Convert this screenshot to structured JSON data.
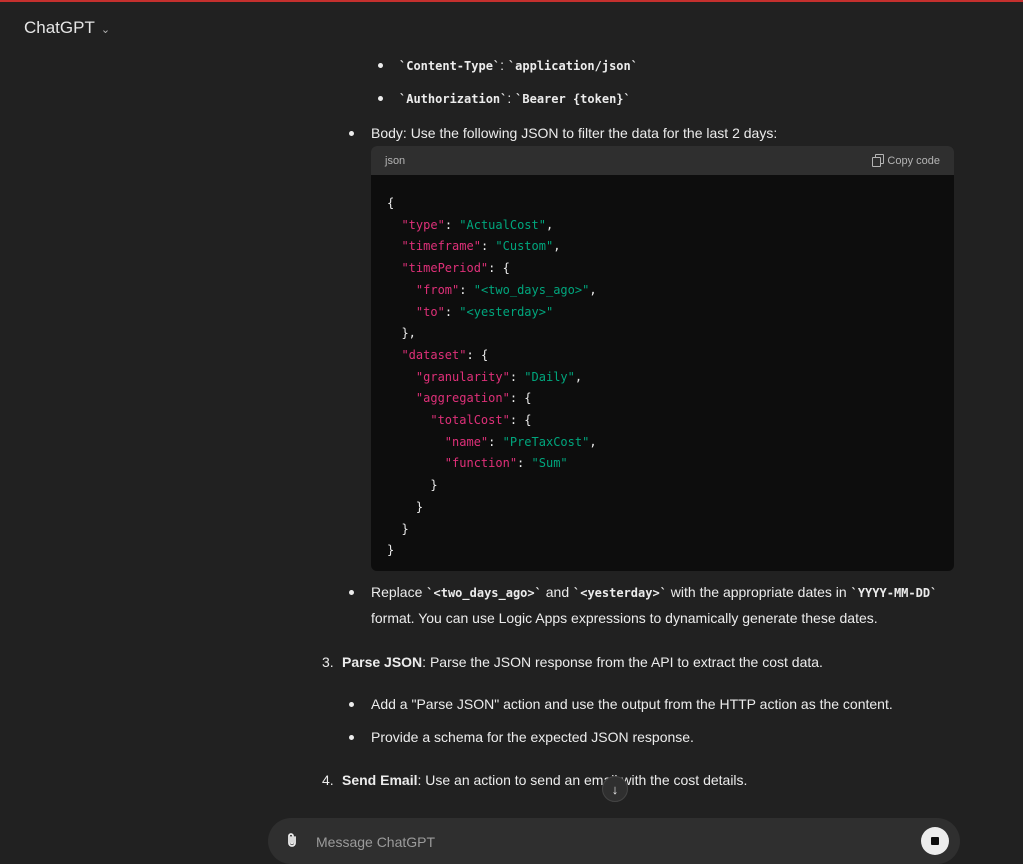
{
  "app": {
    "title": "ChatGPT",
    "chevron": "⌄"
  },
  "headers": {
    "content_type_key": "`Content-Type`",
    "content_type_sep": ": ",
    "content_type_val": "`application/json`",
    "auth_key": "`Authorization`",
    "auth_sep": ": ",
    "auth_val": "`Bearer {token}`"
  },
  "body_line": "Body: Use the following JSON to filter the data for the last 2 days:",
  "code": {
    "language": "json",
    "copy_label": "Copy code",
    "lines": [
      "{",
      "  \"type\": \"ActualCost\",",
      "  \"timeframe\": \"Custom\",",
      "  \"timePeriod\": {",
      "    \"from\": \"<two_days_ago>\",",
      "    \"to\": \"<yesterday>\"",
      "  },",
      "  \"dataset\": {",
      "    \"granularity\": \"Daily\",",
      "    \"aggregation\": {",
      "      \"totalCost\": {",
      "        \"name\": \"PreTaxCost\",",
      "        \"function\": \"Sum\"",
      "      }",
      "    }",
      "  }",
      "}"
    ]
  },
  "replace_line": {
    "part1": "Replace ",
    "code1": "`<two_days_ago>`",
    "part2": " and ",
    "code2": "`<yesterday>`",
    "part3": " with the appropriate dates in ",
    "code3": "`YYYY-MM-DD`",
    "line2": "format. You can use Logic Apps expressions to dynamically generate these dates."
  },
  "step3": {
    "number": "3.",
    "title": "Parse JSON",
    "text": ": Parse the JSON response from the API to extract the cost data.",
    "bullets": [
      "Add a \"Parse JSON\" action and use the output from the HTTP action as the content.",
      "Provide a schema for the expected JSON response."
    ]
  },
  "step4": {
    "number": "4.",
    "title": "Send Email",
    "text": ": Use an action to send an email with the cost details."
  },
  "composer": {
    "placeholder": "Message ChatGPT"
  },
  "icons": {
    "attach": "paperclip-icon",
    "stop": "stop-icon",
    "scroll": "arrow-down-icon",
    "copy": "copy-icon"
  },
  "colors": {
    "key": "#df3079",
    "string": "#00a67d",
    "background": "#212121",
    "code_bg": "#0d0d0d"
  }
}
